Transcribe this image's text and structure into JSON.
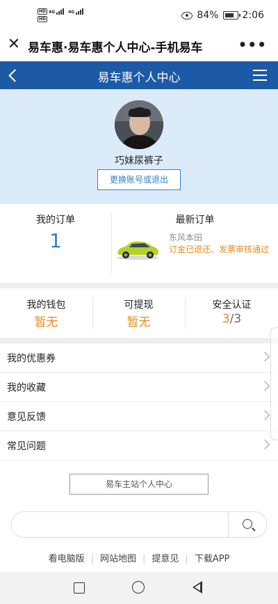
{
  "status_bar": {
    "signal_labels": [
      "HD",
      "4G",
      "4G"
    ],
    "battery": "84%",
    "time": "2:06"
  },
  "browser": {
    "title": "易车惠·易车惠个人中心-手机易车",
    "close_icon": "close-icon",
    "more_icon": "more-icon"
  },
  "nav": {
    "title": "易车惠个人中心",
    "bg_color": "#1c5aa6"
  },
  "profile": {
    "username": "巧妹尿裤子",
    "switch_label": "更换账号或退出"
  },
  "orders": {
    "my_orders_label": "我的订单",
    "my_orders_count": "1",
    "latest_label": "最新订单",
    "brand": "东风本田",
    "status": "订金已退还、发票审核通过"
  },
  "wallet": [
    {
      "label": "我的钱包",
      "value": "暂无"
    },
    {
      "label": "可提现",
      "value": "暂无"
    },
    {
      "label": "安全认证",
      "value_done": "3",
      "value_total": "/3"
    }
  ],
  "menu_items": [
    {
      "label": "我的优惠券"
    },
    {
      "label": "我的收藏"
    },
    {
      "label": "意见反馈"
    },
    {
      "label": "常见问题"
    }
  ],
  "main_site_button": "易车主站个人中心",
  "search": {
    "placeholder": ""
  },
  "footer_links": [
    "看电脑版",
    "网站地图",
    "提意见",
    "下载APP"
  ],
  "accent_colors": {
    "blue": "#2d82c9",
    "orange": "#e68a1a"
  }
}
